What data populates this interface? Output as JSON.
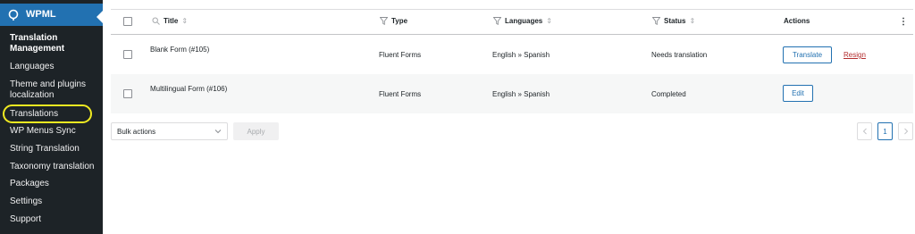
{
  "sidebar": {
    "brand": "WPML",
    "items": [
      {
        "label": "Translation Management",
        "current": true
      },
      {
        "label": "Languages"
      },
      {
        "label": "Theme and plugins localization"
      },
      {
        "label": "Translations",
        "highlighted": true
      },
      {
        "label": "WP Menus Sync"
      },
      {
        "label": "String Translation"
      },
      {
        "label": "Taxonomy translation"
      },
      {
        "label": "Packages"
      },
      {
        "label": "Settings"
      },
      {
        "label": "Support"
      }
    ]
  },
  "table": {
    "columns": {
      "title": "Title",
      "type": "Type",
      "languages": "Languages",
      "status": "Status",
      "actions": "Actions"
    },
    "rows": [
      {
        "title": "Blank Form (#105)",
        "type": "Fluent Forms",
        "languages": "English » Spanish",
        "status": "Needs translation",
        "action": "Translate",
        "secondary_action": "Resign"
      },
      {
        "title": "Multilingual Form (#106)",
        "type": "Fluent Forms",
        "languages": "English » Spanish",
        "status": "Completed",
        "action": "Edit"
      }
    ]
  },
  "bulk": {
    "placeholder": "Bulk actions",
    "apply": "Apply"
  },
  "pagination": {
    "current_page": "1"
  },
  "colors": {
    "sidebar_bg": "#1d2327",
    "brand_blue": "#2271b1",
    "highlight": "#f0ea21",
    "danger": "#b32d2e"
  }
}
